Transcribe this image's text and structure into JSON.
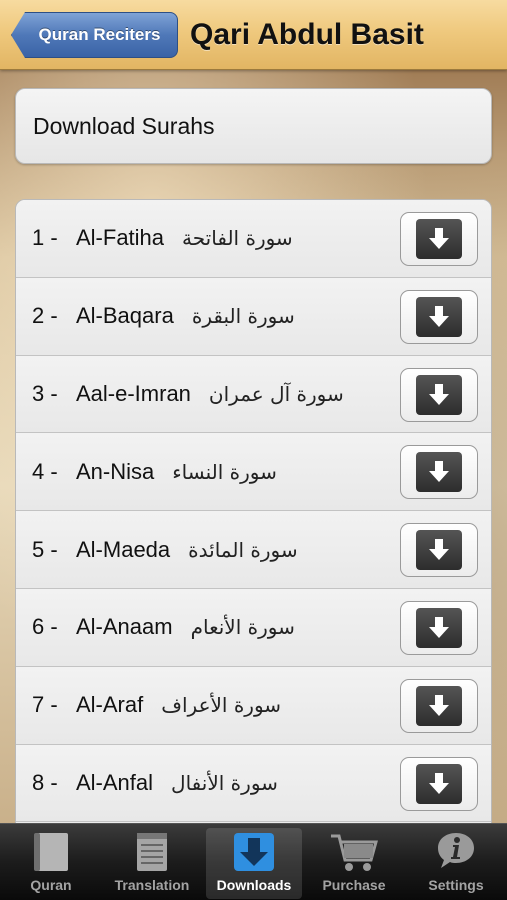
{
  "navbar": {
    "back_label": "Quran Reciters",
    "title": "Qari Abdul Basit"
  },
  "download_surahs_label": "Download Surahs",
  "surahs": [
    {
      "num": "1 -",
      "name": "Al-Fatiha",
      "arabic": "سورة الفاتحة"
    },
    {
      "num": "2 -",
      "name": "Al-Baqara",
      "arabic": "سورة البقرة"
    },
    {
      "num": "3 -",
      "name": "Aal-e-Imran",
      "arabic": "سورة آل عمران"
    },
    {
      "num": "4 -",
      "name": "An-Nisa",
      "arabic": "سورة النساء"
    },
    {
      "num": "5 -",
      "name": "Al-Maeda",
      "arabic": "سورة المائدة"
    },
    {
      "num": "6 -",
      "name": "Al-Anaam",
      "arabic": "سورة الأنعام"
    },
    {
      "num": "7 -",
      "name": "Al-Araf",
      "arabic": "سورة الأعراف"
    },
    {
      "num": "8 -",
      "name": "Al-Anfal",
      "arabic": "سورة الأنفال"
    }
  ],
  "tabs": [
    {
      "label": "Quran",
      "icon": "book-icon"
    },
    {
      "label": "Translation",
      "icon": "notepad-icon"
    },
    {
      "label": "Downloads",
      "icon": "download-icon",
      "active": true
    },
    {
      "label": "Purchase",
      "icon": "cart-icon"
    },
    {
      "label": "Settings",
      "icon": "info-icon"
    }
  ],
  "colors": {
    "navbar": "#efc97e",
    "back_button": "#4f78b8",
    "tabbar": "#1c1c1c"
  }
}
